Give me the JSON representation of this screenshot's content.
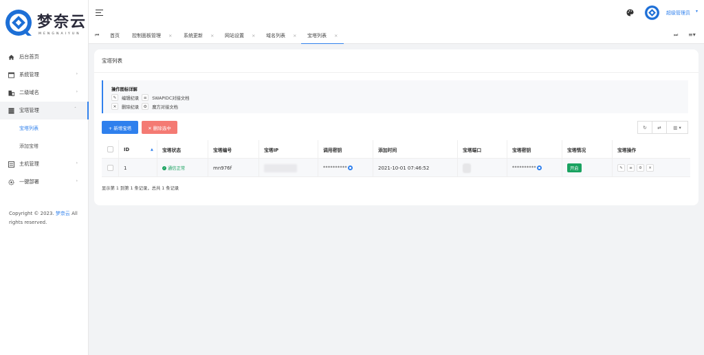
{
  "brand": {
    "title": "梦奈云",
    "subtitle": "MENGNAIYUN"
  },
  "sidebar": {
    "items": [
      {
        "label": "后台首页",
        "icon": "home-icon"
      },
      {
        "label": "系统管理",
        "icon": "window-icon"
      },
      {
        "label": "二级域名",
        "icon": "building-icon"
      },
      {
        "label": "宝塔管理",
        "icon": "server-icon",
        "expanded": true
      },
      {
        "label": "主机管理",
        "icon": "list-icon"
      },
      {
        "label": "一键部署",
        "icon": "gear-icon"
      }
    ],
    "subitems": [
      {
        "label": "宝塔列表",
        "active": true
      },
      {
        "label": "添加宝塔"
      }
    ],
    "copyright_prefix": "Copyright © 2023. ",
    "copyright_brand": "梦奈云",
    "copyright_suffix": " All rights reserved."
  },
  "header": {
    "user": "超级管理员",
    "tabs": [
      "首页",
      "控制面板管理",
      "系统更新",
      "网站设置",
      "域名列表",
      "宝塔列表"
    ],
    "active_tab": "宝塔列表",
    "close_glyph": "×"
  },
  "main": {
    "title": "宝塔列表",
    "legend_title": "操作图标详解",
    "legend_rows": [
      {
        "a_label": "编辑纪录",
        "b_label": "SWAPIDC对接文档"
      },
      {
        "a_label": "删除纪录",
        "b_label": "魔方对接文档"
      }
    ],
    "add_button": "+ 新增宝塔",
    "delete_button": "✕ 删除选中",
    "table": {
      "columns": [
        "ID",
        "宝塔状态",
        "宝塔编号",
        "宝塔IP",
        "调用密钥",
        "添加时间",
        "宝塔端口",
        "宝塔密钥",
        "宝塔情况",
        "宝塔操作"
      ],
      "rows": [
        {
          "id": "1",
          "status": "通信正常",
          "code": "mn976f",
          "call_key": "**********",
          "added": "2021-10-01 07:46:52",
          "bt_key": "**********",
          "state": "开启"
        }
      ]
    },
    "summary": "显示第 1 到第 1 条记录，总共 1 条记录"
  },
  "colors": {
    "accent": "#2f80ed",
    "success": "#1aa260",
    "danger": "#f47a73"
  }
}
